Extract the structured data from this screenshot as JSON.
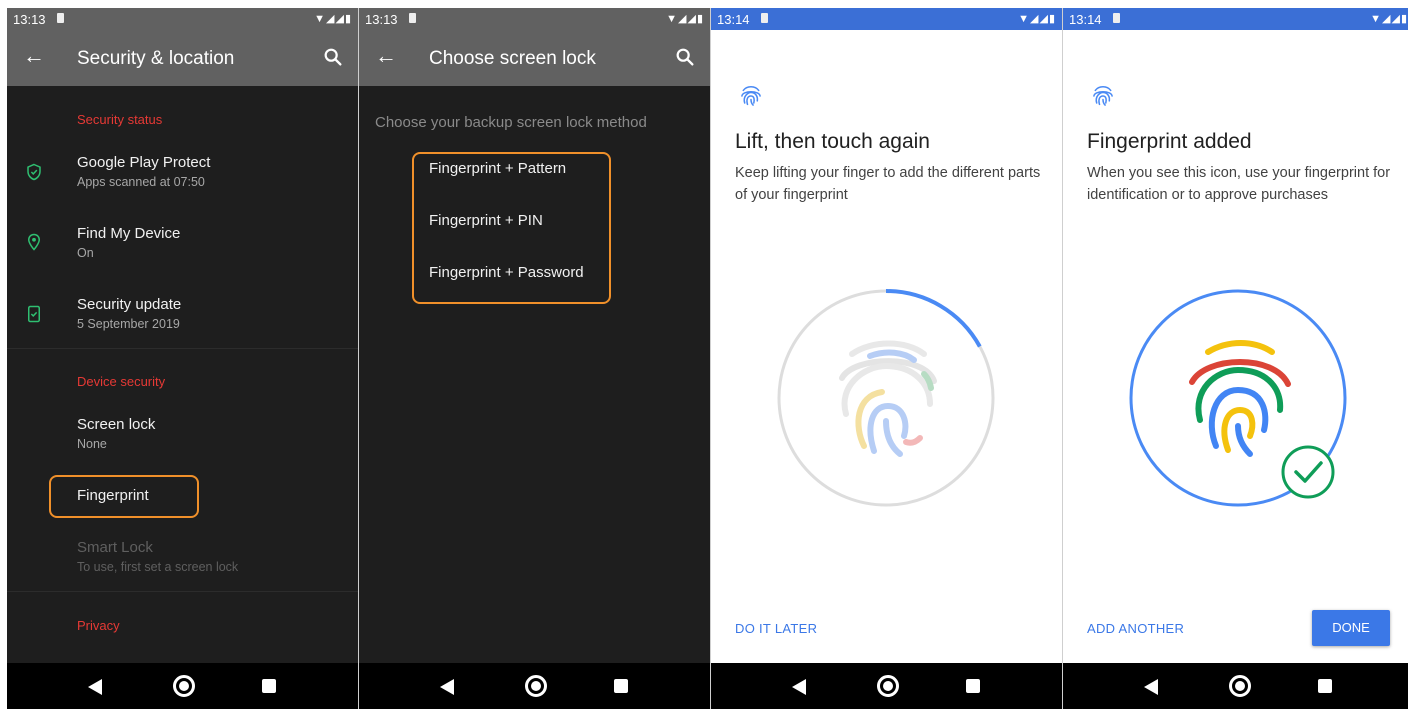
{
  "colors": {
    "dark_bg": "#1e1e1e",
    "appbar": "#616161",
    "accent_red": "#e53935",
    "highlight": "#f0902a",
    "shield_green": "#2fbf71",
    "blue": "#3b78e7"
  },
  "screens": [
    {
      "status": {
        "time": "13:13"
      },
      "appbar": {
        "back_icon": "arrow-left-icon",
        "title": "Security & location",
        "search_icon": "search-icon"
      },
      "sections": {
        "security_status": "Security status",
        "device_security": "Device security",
        "privacy": "Privacy"
      },
      "items": [
        {
          "icon": "shield-check-icon",
          "title": "Google Play Protect",
          "subtitle": "Apps scanned at 07:50"
        },
        {
          "icon": "location-pin-icon",
          "title": "Find My Device",
          "subtitle": "On"
        },
        {
          "icon": "security-update-icon",
          "title": "Security update",
          "subtitle": "5 September 2019"
        },
        {
          "title": "Screen lock",
          "subtitle": "None"
        },
        {
          "title": "Fingerprint"
        },
        {
          "title": "Smart Lock",
          "subtitle": "To use, first set a screen lock",
          "disabled": true
        }
      ]
    },
    {
      "status": {
        "time": "13:13"
      },
      "appbar": {
        "back_icon": "arrow-left-icon",
        "title": "Choose screen lock",
        "search_icon": "search-icon"
      },
      "subtitle": "Choose your backup screen lock method",
      "options": [
        "Fingerprint + Pattern",
        "Fingerprint + PIN",
        "Fingerprint + Password"
      ]
    },
    {
      "status": {
        "time": "13:14"
      },
      "title": "Lift, then touch again",
      "description": "Keep lifting your finger to add the different parts of your fingerprint",
      "progress_fraction": 0.17,
      "action_left": "DO IT LATER"
    },
    {
      "status": {
        "time": "13:14"
      },
      "title": "Fingerprint added",
      "description": "When you see this icon, use your fingerprint for identification or to approve purchases",
      "action_left": "ADD ANOTHER",
      "action_right": "DONE"
    }
  ]
}
